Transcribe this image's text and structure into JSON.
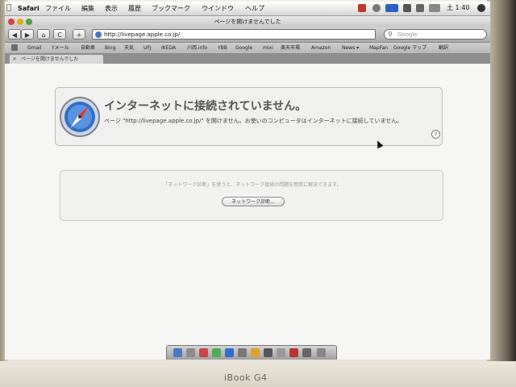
{
  "menubar": {
    "app": "Safari",
    "items": [
      "ファイル",
      "編集",
      "表示",
      "履歴",
      "ブックマーク",
      "ウインドウ",
      "ヘルプ"
    ],
    "clock": "土 1:40"
  },
  "window": {
    "title": "ページを開けませんでした"
  },
  "toolbar": {
    "url": "http://livepage.apple.co.jp/",
    "search_placeholder": "Google",
    "back_label": "◀",
    "forward_label": "▶",
    "home_label": "⌂",
    "reload_label": "C",
    "add_label": "+"
  },
  "bookmarks": [
    "Gmail",
    "Yメール",
    "自動車",
    "Bing",
    "天気",
    "UFJ",
    "IKEDA",
    "川西.info",
    "YBB",
    "Google",
    "mixi",
    "楽天市場",
    "Amazon",
    "News ▾",
    "MapFan",
    "Google マップ",
    "翻訳"
  ],
  "tab": {
    "label": "ページを開けませんでした",
    "close": "×"
  },
  "error": {
    "heading": "インターネットに接続されていません。",
    "description": "ページ \"http://livepage.apple.co.jp/\" を開けません。お使いのコンピュータはインターネットに接続していません。",
    "help": "?"
  },
  "diagnostics": {
    "text": "「ネットワーク診断」を使うと、ネットワーク接続の問題を簡単に解決できます。",
    "button": "ネットワーク診断..."
  },
  "bezel": {
    "brand": "iBook G4"
  },
  "colors": {
    "accent": "#4a78c2",
    "compass": "#2f6fc9"
  }
}
